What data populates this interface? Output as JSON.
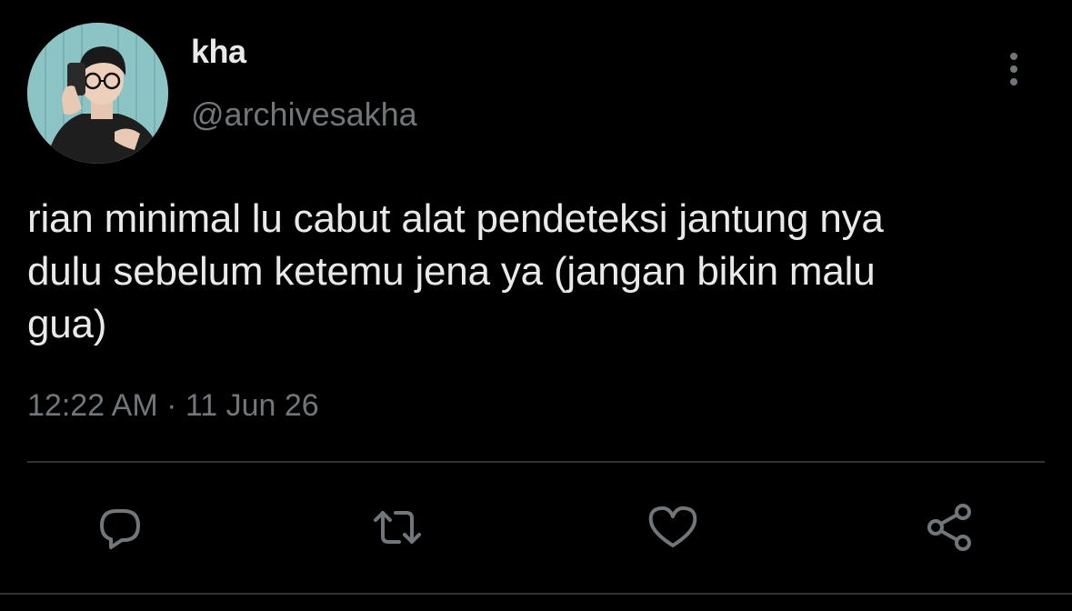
{
  "author": {
    "display_name": "kha",
    "handle": "@archivesakha"
  },
  "tweet": {
    "text": "rian minimal lu cabut alat pendeteksi jantung nya\ndulu sebelum ketemu jena ya (jangan bikin malu\ngua)",
    "time": "12:22 AM",
    "separator": "·",
    "date": "11 Jun 26"
  },
  "actions": {
    "reply_icon": "comment-icon",
    "retweet_icon": "retweet-icon",
    "like_icon": "heart-icon",
    "share_icon": "share-icon",
    "more_icon": "more-vertical-icon"
  },
  "colors": {
    "background": "#000000",
    "primary_text": "#e7e9ea",
    "secondary_text": "#71767b",
    "divider": "#2f3336",
    "icon": "#71767b"
  }
}
